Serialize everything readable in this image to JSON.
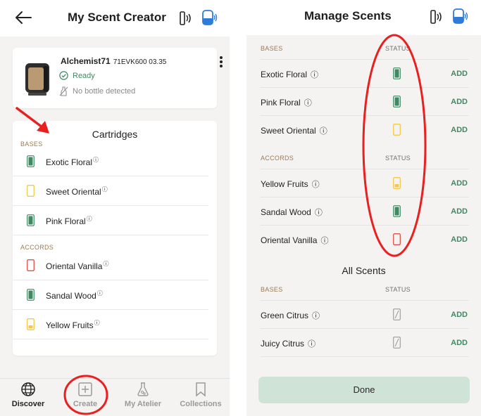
{
  "left": {
    "header": {
      "title": "My Scent Creator",
      "back_icon": "arrow-left-icon",
      "remote_icon": "remote-signal-icon",
      "device_icon": "device-signal-icon"
    },
    "device": {
      "name": "Alchemist71",
      "serial": "71EVK600 03.35",
      "status": "Ready",
      "bottle_status": "No bottle detected"
    },
    "cartridges": {
      "title": "Cartridges",
      "bases_label": "BASES",
      "accords_label": "ACCORDS",
      "bases": [
        {
          "name": "Exotic Floral",
          "state": "full"
        },
        {
          "name": "Sweet Oriental",
          "state": "empty-yellow"
        },
        {
          "name": "Pink Floral",
          "state": "full"
        }
      ],
      "accords": [
        {
          "name": "Oriental Vanilla",
          "state": "empty-red"
        },
        {
          "name": "Sandal Wood",
          "state": "full"
        },
        {
          "name": "Yellow Fruits",
          "state": "low-yellow"
        }
      ]
    },
    "nav": [
      {
        "label": "Discover",
        "icon": "globe-icon"
      },
      {
        "label": "Create",
        "icon": "plus-square-icon"
      },
      {
        "label": "My Atelier",
        "icon": "flask-icon"
      },
      {
        "label": "Collections",
        "icon": "bookmark-icon"
      }
    ]
  },
  "right": {
    "header": {
      "title": "Manage Scents"
    },
    "bases_label": "BASES",
    "accords_label": "ACCORDS",
    "status_label": "STATUS",
    "add_label": "ADD",
    "bases": [
      {
        "name": "Exotic Floral",
        "state": "full"
      },
      {
        "name": "Pink Floral",
        "state": "full"
      },
      {
        "name": "Sweet Oriental",
        "state": "empty-yellow"
      }
    ],
    "accords": [
      {
        "name": "Yellow Fruits",
        "state": "low-yellow"
      },
      {
        "name": "Sandal Wood",
        "state": "full"
      },
      {
        "name": "Oriental Vanilla",
        "state": "empty-red"
      }
    ],
    "all_scents_title": "All Scents",
    "all_bases": [
      {
        "name": "Green Citrus",
        "state": "none"
      },
      {
        "name": "Juicy Citrus",
        "state": "none"
      }
    ],
    "done_label": "Done"
  },
  "colors": {
    "green": "#3e8a62",
    "yellow": "#f2c94c",
    "red": "#e0504a",
    "gold": "#9a7b4f",
    "annotation": "#e8201f"
  }
}
